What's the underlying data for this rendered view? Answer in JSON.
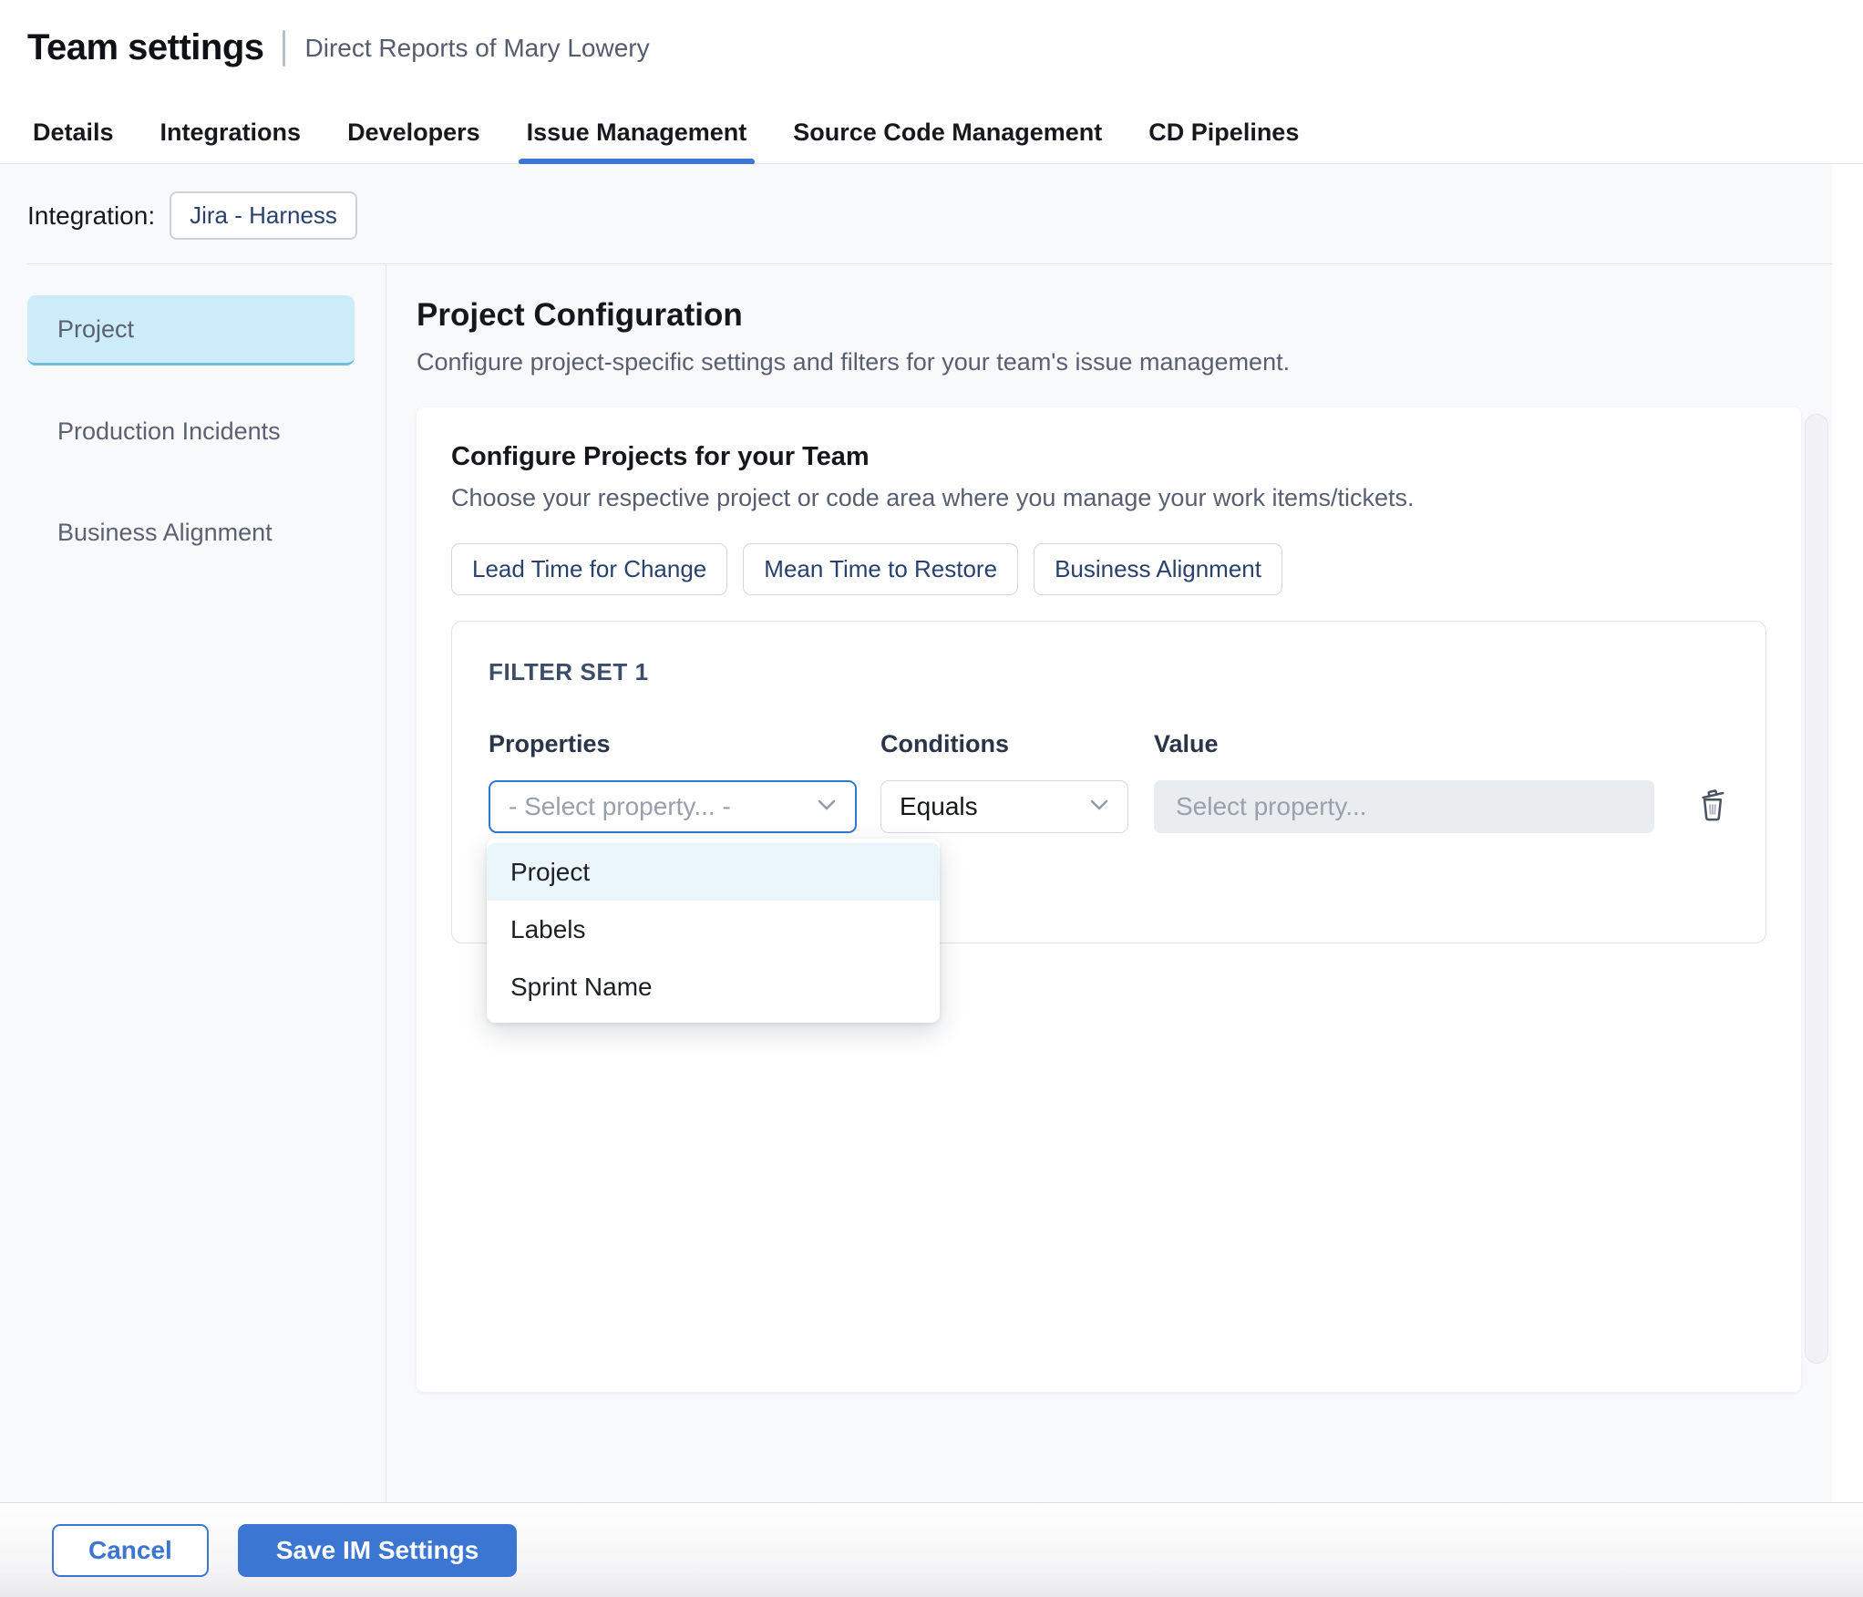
{
  "header": {
    "title": "Team settings",
    "subtitle": "Direct Reports of Mary Lowery"
  },
  "tabs": {
    "items": [
      {
        "label": "Details",
        "active": false
      },
      {
        "label": "Integrations",
        "active": false
      },
      {
        "label": "Developers",
        "active": false
      },
      {
        "label": "Issue Management",
        "active": true
      },
      {
        "label": "Source Code Management",
        "active": false
      },
      {
        "label": "CD Pipelines",
        "active": false
      }
    ]
  },
  "integration": {
    "label": "Integration:",
    "chip": "Jira - Harness"
  },
  "sidebar": {
    "items": [
      {
        "label": "Project",
        "active": true
      },
      {
        "label": "Production Incidents",
        "active": false
      },
      {
        "label": "Business Alignment",
        "active": false
      }
    ]
  },
  "main": {
    "title": "Project Configuration",
    "description": "Configure project-specific settings and filters for your team's issue management.",
    "card": {
      "title": "Configure Projects for your Team",
      "subtitle": "Choose your respective project or code area where you manage your work items/tickets.",
      "chips": [
        "Lead Time for Change",
        "Mean Time to Restore",
        "Business Alignment"
      ],
      "filter_set": {
        "title": "FILTER SET 1",
        "columns": {
          "properties": "Properties",
          "conditions": "Conditions",
          "value": "Value"
        },
        "property_select": {
          "value": "- Select property... -"
        },
        "condition_select": {
          "value": "Equals"
        },
        "value_input": {
          "placeholder": "Select property..."
        },
        "options": [
          {
            "label": "Project",
            "highlighted": true
          },
          {
            "label": "Labels",
            "highlighted": false
          },
          {
            "label": "Sprint Name",
            "highlighted": false
          }
        ]
      }
    }
  },
  "footer": {
    "cancel_label": "Cancel",
    "save_label": "Save IM Settings"
  },
  "colors": {
    "accent_blue": "#3a76d2",
    "focus_border": "#2e78d2",
    "sidebar_selected_bg": "#cdecf9",
    "sidebar_selected_edge": "#6fbddd",
    "option_highlight_bg": "#ebf6fb",
    "disabled_input_bg": "#e9edf0",
    "chip_text": "#29416f",
    "content_bg": "#f8f9fb"
  }
}
